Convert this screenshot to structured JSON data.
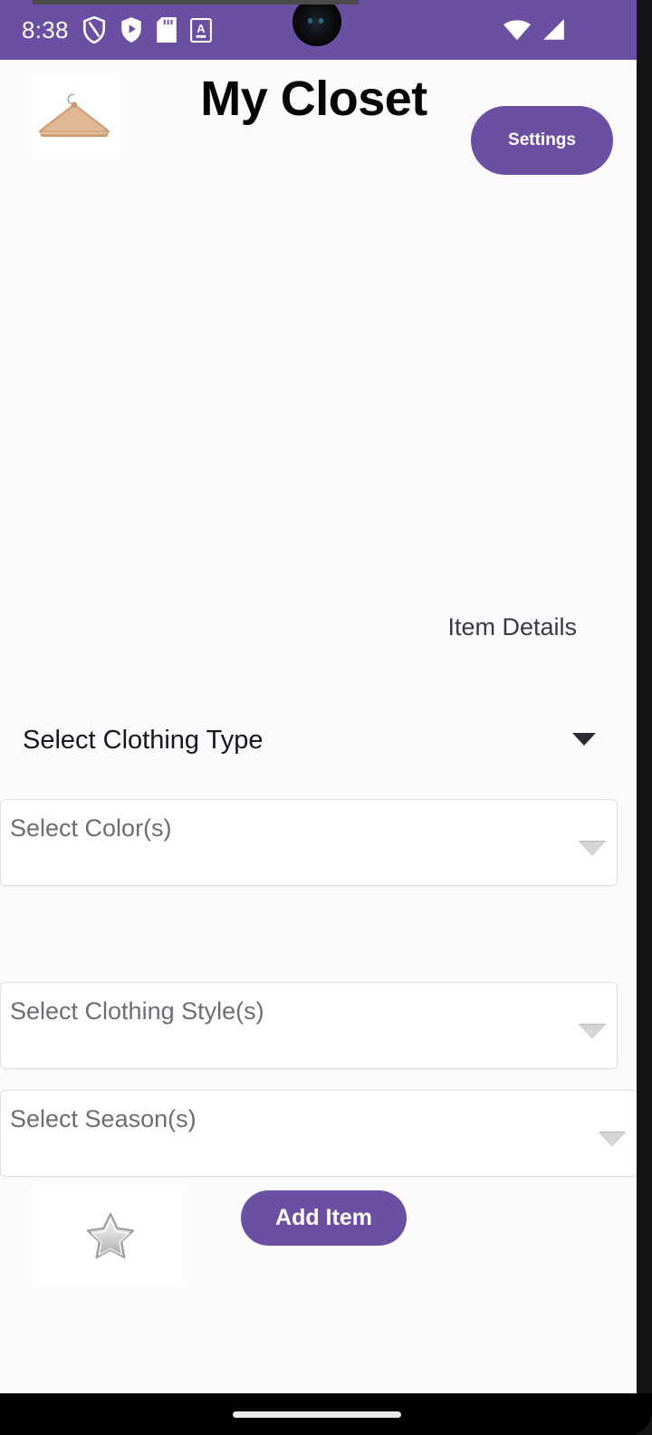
{
  "status_bar": {
    "time": "8:38",
    "left_icons": [
      "shield-slash-icon",
      "shield-play-icon",
      "sd-card-icon",
      "a-box-icon"
    ],
    "right_icons": [
      "wifi-icon",
      "cell-signal-icon"
    ],
    "background_color": "#6A4FA3"
  },
  "header": {
    "logo_icon": "clothes-hanger-icon",
    "title": "My Closet",
    "settings_label": "Settings",
    "accent_color": "#6A4FA3"
  },
  "main": {
    "section_label": "Item Details",
    "clothing_type": {
      "label": "Select Clothing Type",
      "caret_icon": "chevron-down-icon"
    },
    "color_select": {
      "placeholder": "Select Color(s)",
      "caret_icon": "chevron-down-icon"
    },
    "style_select": {
      "placeholder": "Select Clothing Style(s)",
      "caret_icon": "chevron-down-icon"
    },
    "season_select": {
      "placeholder": "Select Season(s)",
      "caret_icon": "chevron-down-icon"
    },
    "favorite_icon": "star-icon",
    "add_item_label": "Add Item"
  },
  "nav_bar": {
    "gesture_handle": "home-gesture-pill"
  }
}
